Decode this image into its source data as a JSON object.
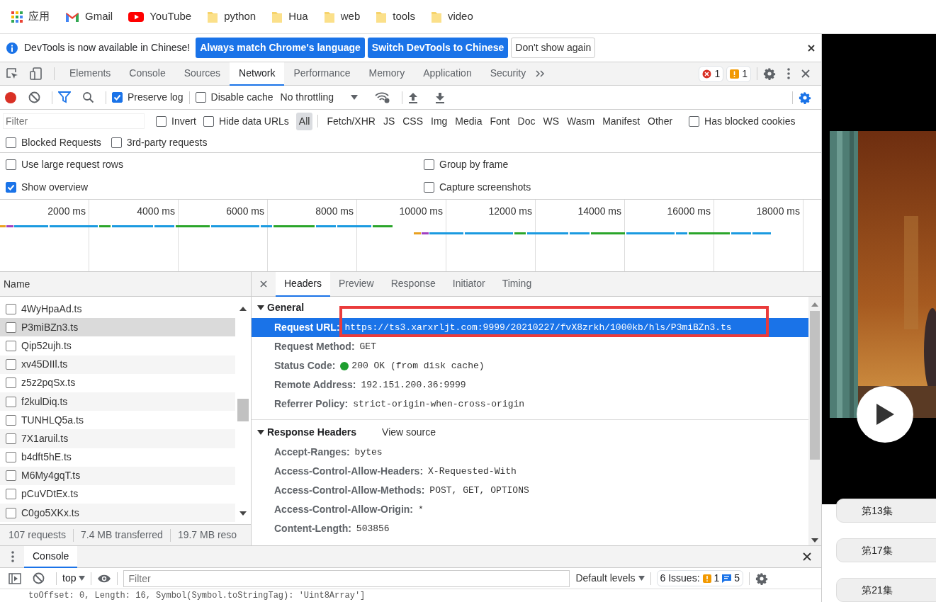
{
  "bookmarks": [
    {
      "label": "应用",
      "kind": "apps"
    },
    {
      "label": "Gmail",
      "kind": "gmail"
    },
    {
      "label": "YouTube",
      "kind": "youtube"
    },
    {
      "label": "python",
      "kind": "folder"
    },
    {
      "label": "Hua",
      "kind": "folder"
    },
    {
      "label": "web",
      "kind": "folder"
    },
    {
      "label": "tools",
      "kind": "folder"
    },
    {
      "label": "video",
      "kind": "folder"
    }
  ],
  "infobar": {
    "message": "DevTools is now available in Chinese!",
    "buttons": [
      {
        "label": "Always match Chrome's language",
        "kind": "primary"
      },
      {
        "label": "Switch DevTools to Chinese",
        "kind": "primary"
      },
      {
        "label": "Don't show again",
        "kind": "plain"
      }
    ]
  },
  "devtools_tabs": [
    {
      "label": "Elements",
      "selected": false
    },
    {
      "label": "Console",
      "selected": false
    },
    {
      "label": "Sources",
      "selected": false
    },
    {
      "label": "Network",
      "selected": true
    },
    {
      "label": "Performance",
      "selected": false
    },
    {
      "label": "Memory",
      "selected": false
    },
    {
      "label": "Application",
      "selected": false
    },
    {
      "label": "Security",
      "selected": false
    }
  ],
  "issue_counts": {
    "errors": "1",
    "warnings": "1"
  },
  "toolbar": {
    "preserve_log": {
      "label": "Preserve log",
      "checked": true
    },
    "disable_cache": {
      "label": "Disable cache",
      "checked": false
    },
    "throttling": "No throttling"
  },
  "filter_bar": {
    "placeholder": "Filter",
    "checkboxes": [
      {
        "label": "Invert",
        "checked": false
      },
      {
        "label": "Hide data URLs",
        "checked": false
      }
    ],
    "types": [
      {
        "label": "All",
        "selected": true
      },
      {
        "label": "Fetch/XHR",
        "selected": false
      },
      {
        "label": "JS",
        "selected": false
      },
      {
        "label": "CSS",
        "selected": false
      },
      {
        "label": "Img",
        "selected": false
      },
      {
        "label": "Media",
        "selected": false
      },
      {
        "label": "Font",
        "selected": false
      },
      {
        "label": "Doc",
        "selected": false
      },
      {
        "label": "WS",
        "selected": false
      },
      {
        "label": "Wasm",
        "selected": false
      },
      {
        "label": "Manifest",
        "selected": false
      },
      {
        "label": "Other",
        "selected": false
      }
    ],
    "blocked_cookies": {
      "label": "Has blocked cookies",
      "checked": false
    },
    "more": [
      {
        "label": "Blocked Requests",
        "checked": false
      },
      {
        "label": "3rd-party requests",
        "checked": false
      }
    ]
  },
  "settings": [
    {
      "label": "Use large request rows",
      "checked": false
    },
    {
      "label": "Group by frame",
      "checked": false
    },
    {
      "label": "Show overview",
      "checked": true
    },
    {
      "label": "Capture screenshots",
      "checked": false
    }
  ],
  "overview": {
    "ticks": [
      "2000 ms",
      "4000 ms",
      "6000 ms",
      "8000 ms",
      "10000 ms",
      "12000 ms",
      "14000 ms",
      "16000 ms",
      "18000 ms"
    ]
  },
  "requests": {
    "column": "Name",
    "rows": [
      {
        "name": "4WyHpaAd.ts",
        "selected": false
      },
      {
        "name": "P3miBZn3.ts",
        "selected": true
      },
      {
        "name": "Qip52ujh.ts",
        "selected": false
      },
      {
        "name": "xv45DIIl.ts",
        "selected": false
      },
      {
        "name": "z5z2pqSx.ts",
        "selected": false
      },
      {
        "name": "f2kulDiq.ts",
        "selected": false
      },
      {
        "name": "TUNHLQ5a.ts",
        "selected": false
      },
      {
        "name": "7X1aruil.ts",
        "selected": false
      },
      {
        "name": "b4dft5hE.ts",
        "selected": false
      },
      {
        "name": "M6My4gqT.ts",
        "selected": false
      },
      {
        "name": "pCuVDtEx.ts",
        "selected": false
      },
      {
        "name": "C0go5XKx.ts",
        "selected": false
      }
    ]
  },
  "summary": [
    "107 requests",
    "7.4 MB transferred",
    "19.7 MB reso"
  ],
  "detail_tabs": [
    {
      "label": "Headers",
      "selected": true
    },
    {
      "label": "Preview",
      "selected": false
    },
    {
      "label": "Response",
      "selected": false
    },
    {
      "label": "Initiator",
      "selected": false
    },
    {
      "label": "Timing",
      "selected": false
    }
  ],
  "general": {
    "title": "General",
    "fields": [
      {
        "label": "Request URL:",
        "value": "https://ts3.xarxrljt.com:9999/20210227/fvX8zrkh/1000kb/hls/P3miBZn3.ts",
        "selected": true
      },
      {
        "label": "Request Method:",
        "value": "GET",
        "selected": false
      },
      {
        "label": "Status Code:",
        "value": "200 OK (from disk cache)",
        "selected": false,
        "kind": "status"
      },
      {
        "label": "Remote Address:",
        "value": "192.151.200.36:9999",
        "selected": false
      },
      {
        "label": "Referrer Policy:",
        "value": "strict-origin-when-cross-origin",
        "selected": false
      }
    ]
  },
  "response_headers": {
    "title": "Response Headers",
    "link": "View source",
    "fields": [
      {
        "label": "Accept-Ranges:",
        "value": "bytes"
      },
      {
        "label": "Access-Control-Allow-Headers:",
        "value": "X-Requested-With"
      },
      {
        "label": "Access-Control-Allow-Methods:",
        "value": "POST, GET, OPTIONS"
      },
      {
        "label": "Access-Control-Allow-Origin:",
        "value": "*"
      },
      {
        "label": "Content-Length:",
        "value": "503856"
      }
    ]
  },
  "drawer": {
    "tab": "Console",
    "context": "top",
    "filter_placeholder": "Filter",
    "levels": "Default levels",
    "issues": {
      "label": "6 Issues:",
      "warnings": "1",
      "messages": "5"
    },
    "output": "toOffset: 0, Length: 16, Symbol(Symbol.toStringTag): 'Uint8Array']"
  },
  "video": {
    "kind": "picture",
    "episodes": [
      "第13集",
      "第17集",
      "第21集"
    ]
  }
}
